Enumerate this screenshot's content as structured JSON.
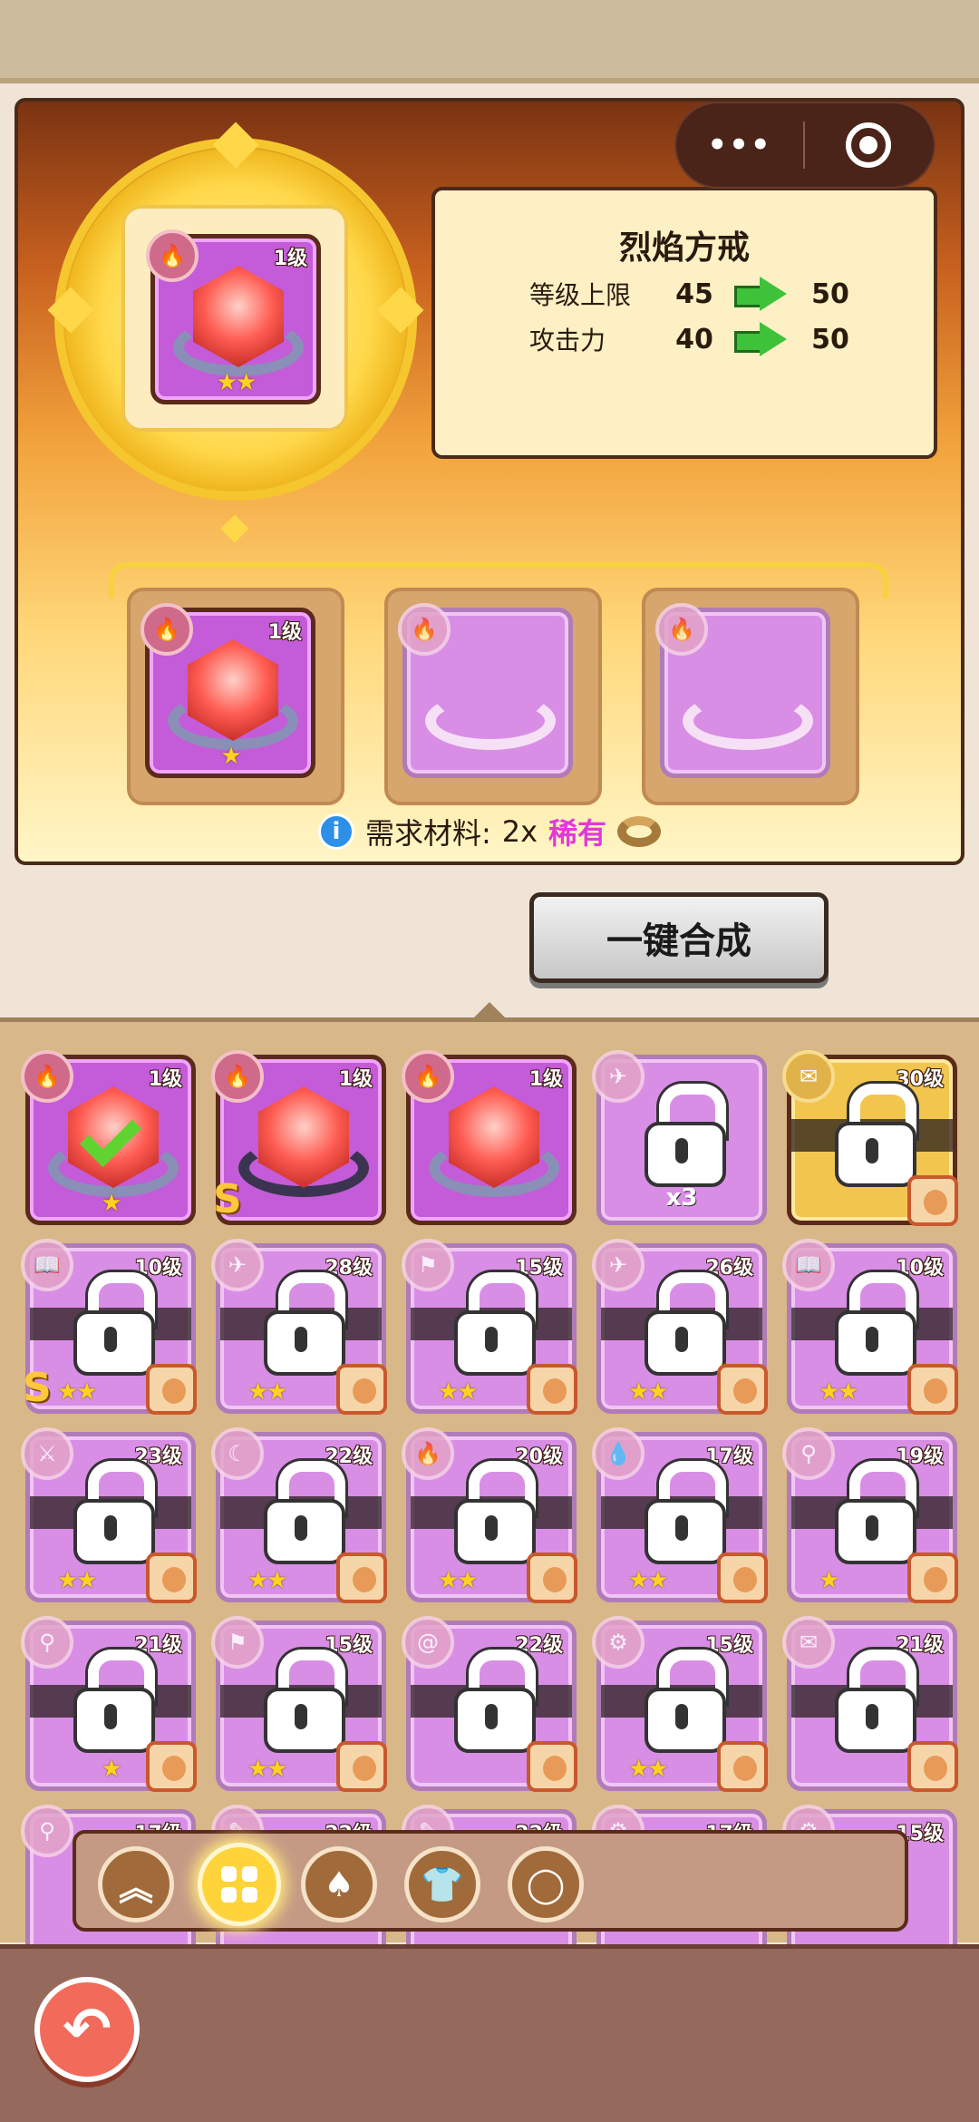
{
  "capsule": {
    "menu_dots": "•••",
    "close_icon": "target-icon"
  },
  "preview": {
    "item_level": "1级",
    "item_stars": "★★"
  },
  "info": {
    "title": "烈焰方戒",
    "stats": [
      {
        "label": "等级上限",
        "from": "45",
        "to": "50"
      },
      {
        "label": "攻击力",
        "from": "40",
        "to": "50"
      }
    ]
  },
  "slots": [
    {
      "filled": true,
      "level": "1级",
      "stars": "★"
    },
    {
      "filled": false
    },
    {
      "filled": false
    }
  ],
  "requirement": {
    "label": "需求材料:",
    "count": "2x",
    "rarity": "稀有"
  },
  "merge_button": "一键合成",
  "inventory": {
    "row1": [
      {
        "level": "1级",
        "stars": "★",
        "selected": true
      },
      {
        "level": "1级",
        "badge": "S"
      },
      {
        "level": "1级"
      },
      {
        "locked": true,
        "count": "x3"
      },
      {
        "locked": true,
        "level": "30级"
      }
    ],
    "row2_levels": [
      "10级",
      "28级",
      "15级",
      "26级",
      "10级"
    ],
    "row3_levels": [
      "23级",
      "22级",
      "20级",
      "17级",
      "19级"
    ],
    "row4_levels": [
      "21级",
      "15级",
      "22级",
      "15级",
      "21级"
    ],
    "row5_levels": [
      "17级",
      "22级",
      "22级",
      "17级",
      "15级"
    ],
    "locked_stars": [
      "★★",
      "★★",
      "★★",
      "★★",
      "★★"
    ],
    "row3_stars": [
      "★★",
      "★★",
      "★★",
      "★★",
      "★"
    ],
    "row4_stars": [
      "★",
      "★★",
      "",
      "★★",
      ""
    ],
    "badge_s": "S"
  },
  "tabs": [
    {
      "name": "upgrade-tab",
      "icon": "double-chevron-up-icon",
      "glyph": "︽"
    },
    {
      "name": "all-tab",
      "icon": "grid-icon",
      "active": true
    },
    {
      "name": "helmet-tab",
      "icon": "helmet-icon",
      "glyph": "♠"
    },
    {
      "name": "armor-tab",
      "icon": "shirt-icon",
      "glyph": "👕"
    },
    {
      "name": "ring-tab",
      "icon": "ring-icon",
      "glyph": "◯"
    }
  ],
  "back_button": {
    "icon": "back-arrow-icon",
    "glyph": "↶"
  }
}
